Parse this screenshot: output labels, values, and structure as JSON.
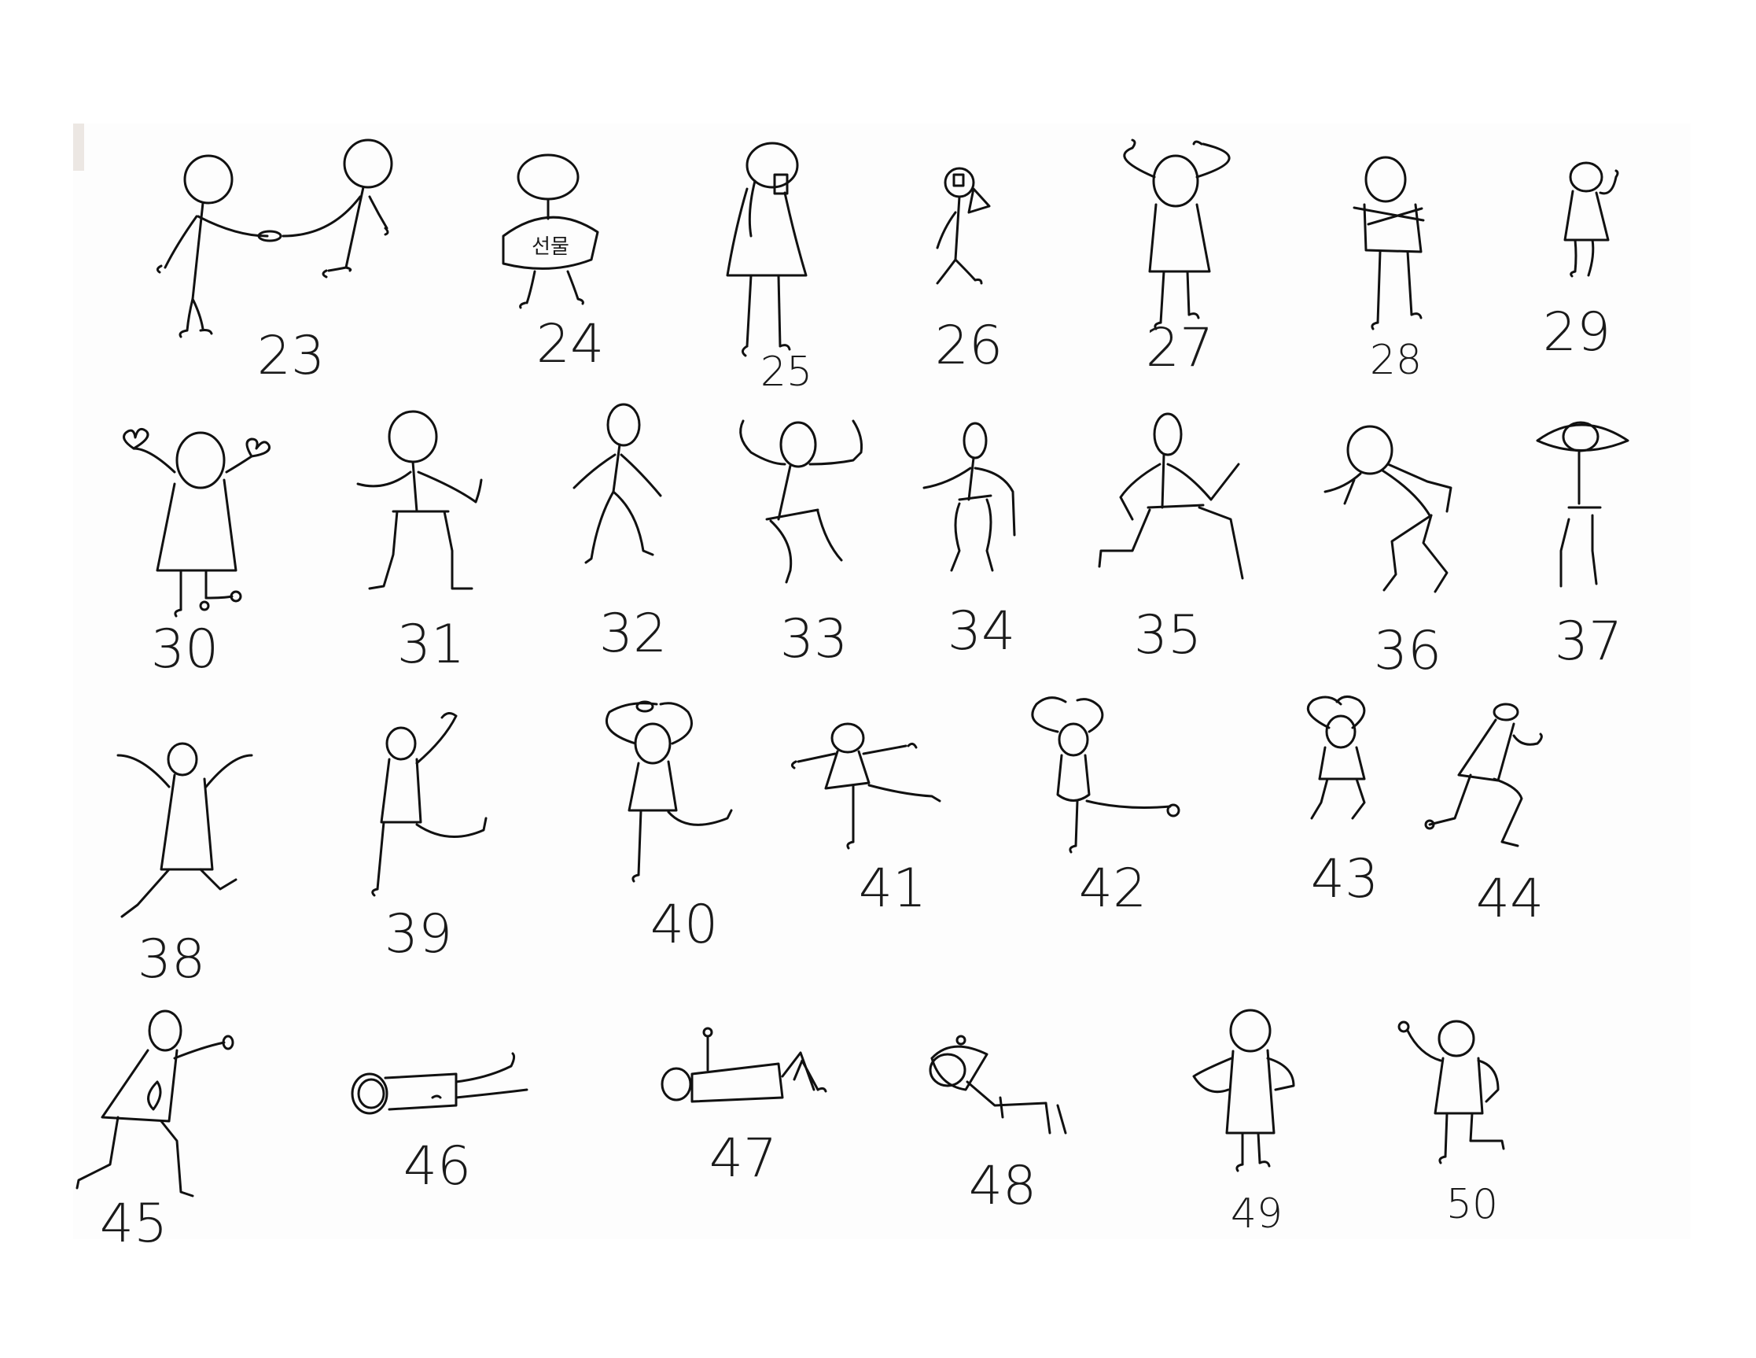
{
  "sheet": {
    "background": "#ffffff",
    "ink_color": "#111111",
    "figure_labels": [
      "23",
      "24",
      "25",
      "26",
      "27",
      "28",
      "29",
      "30",
      "31",
      "32",
      "33",
      "34",
      "35",
      "36",
      "37",
      "38",
      "39",
      "40",
      "41",
      "42",
      "43",
      "44",
      "45",
      "46",
      "47",
      "48",
      "49",
      "50"
    ],
    "sign_text": "선물"
  }
}
